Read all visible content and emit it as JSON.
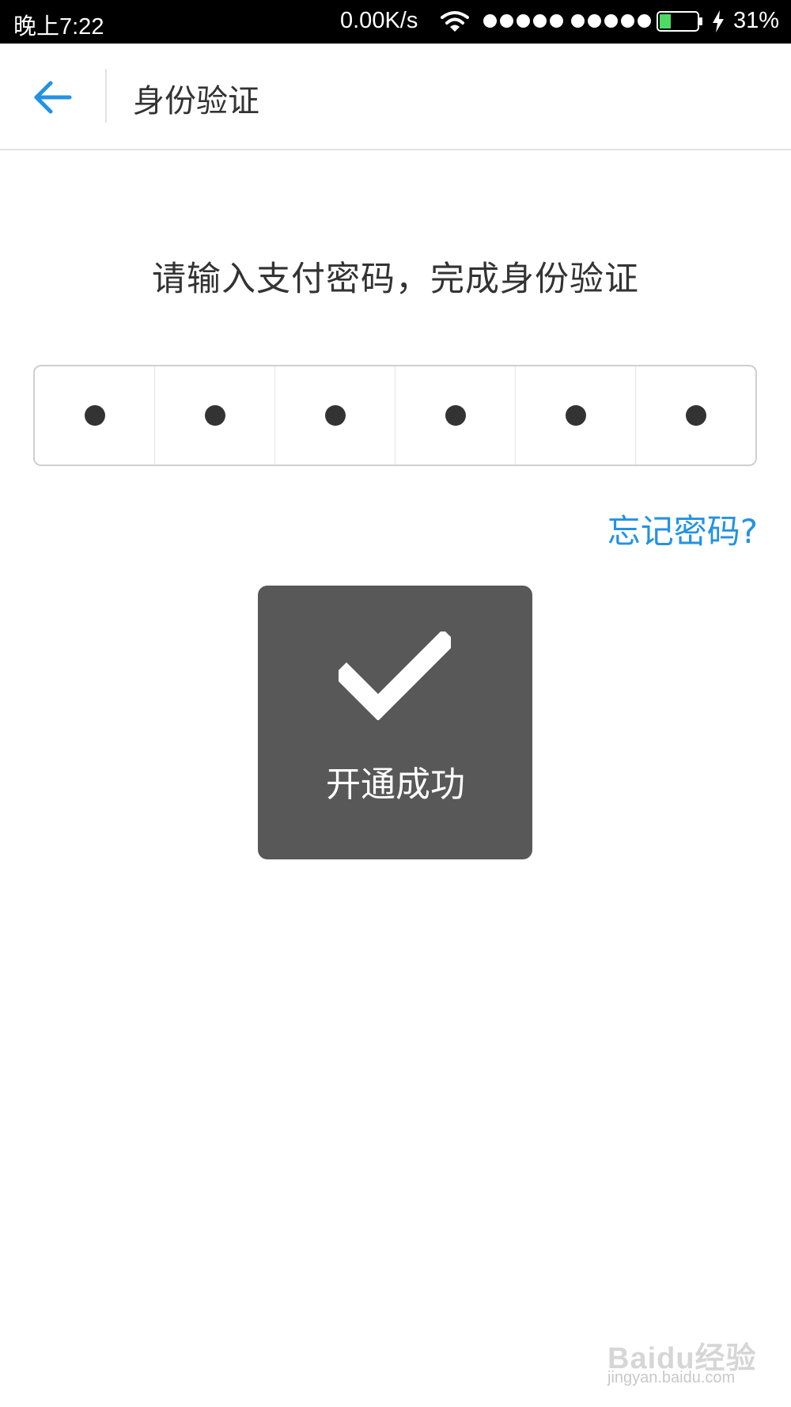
{
  "status_bar": {
    "time": "晚上7:22",
    "net_speed": "0.00K/s",
    "battery_percent": "31%",
    "battery_level": 0.31,
    "icons": [
      "wifi-icon",
      "signal-icon",
      "signal-icon",
      "battery-icon",
      "charging-icon"
    ]
  },
  "header": {
    "back_icon": "arrow-left-icon",
    "title": "身份验证"
  },
  "main": {
    "prompt": "请输入支付密码，完成身份验证",
    "pin_length": 6,
    "pin_filled": 6,
    "forgot_link": "忘记密码?"
  },
  "toast": {
    "icon": "checkmark-icon",
    "message": "开通成功"
  },
  "watermark": {
    "brand": "Baidu经验",
    "url": "jingyan.baidu.com"
  },
  "colors": {
    "accent": "#2492e3",
    "toast_bg": "#585858",
    "text": "#333333"
  }
}
